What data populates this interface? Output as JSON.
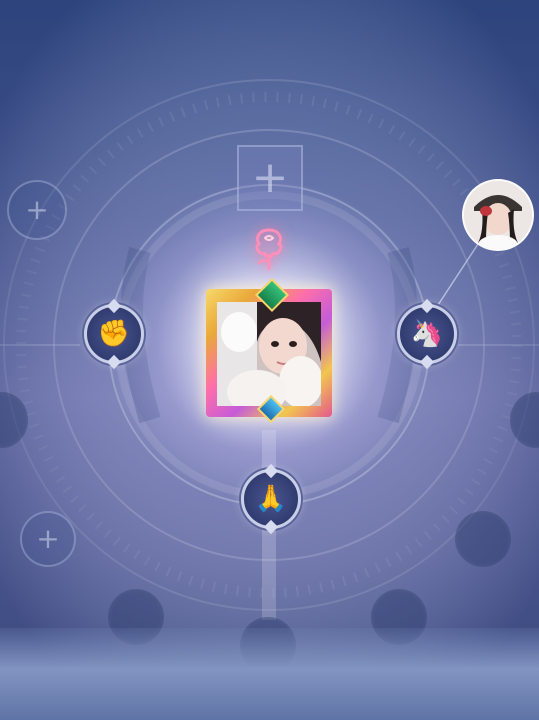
{
  "screen": "couple-space-intimacy-tree",
  "colors": {
    "background_top": "#3c5793",
    "background_mid": "#7b80bc",
    "glow": "#ffffff",
    "badge_fill": "#2f3a6e",
    "badge_rim": "#c9cfe8",
    "rose": "#ff6fa8",
    "frame_gold": "#f2c64f",
    "frame_pink": "#ff6fa8",
    "gem_green": "#36c27a",
    "gem_blue": "#4fc0f0"
  },
  "center": {
    "avatar": {
      "description": "user-portrait",
      "frame": "gold-pink-crystal-frame"
    },
    "rose_icon": "rose-icon",
    "add_slot_top": {
      "glyph": "+"
    }
  },
  "relation_badges": [
    {
      "id": "left",
      "icon": "fist-bump-icon",
      "glyph": "✊"
    },
    {
      "id": "right",
      "icon": "unicorn-icon",
      "glyph": "🦄"
    },
    {
      "id": "bottom",
      "icon": "praying-hands-icon",
      "glyph": "🙏"
    }
  ],
  "add_slots": [
    {
      "id": "top-left",
      "glyph": "+"
    },
    {
      "id": "mid-left",
      "glyph": "+"
    }
  ],
  "empty_slots": [
    "left-edge",
    "right-edge",
    "bottom-left",
    "bottom-right",
    "bottom-center",
    "bottom-far-right"
  ],
  "friend": {
    "avatar": "friend-portrait-cap"
  }
}
